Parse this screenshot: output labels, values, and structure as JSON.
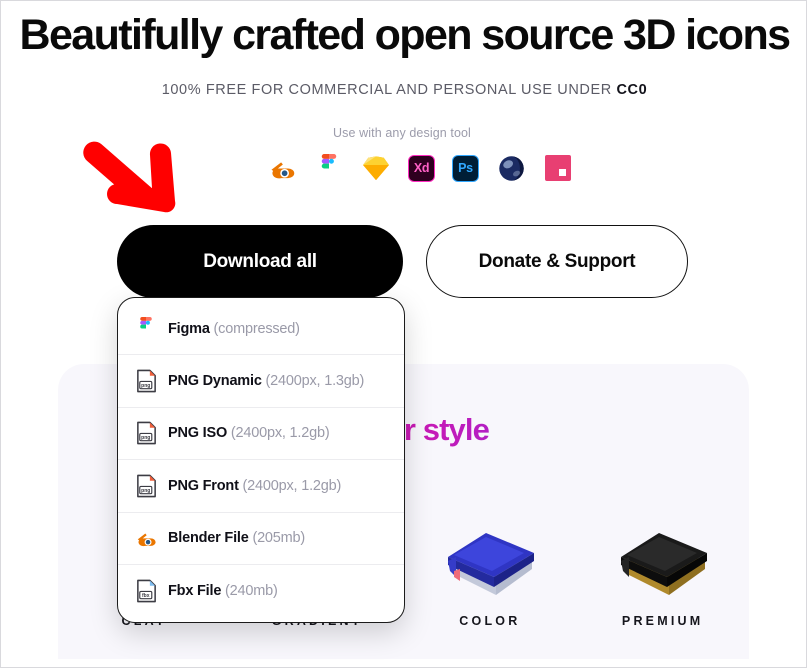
{
  "hero": {
    "title": "Beautifully crafted open source 3D icons",
    "subtitle_prefix": "100% FREE FOR COMMERCIAL AND PERSONAL USE UNDER ",
    "license": "CC0"
  },
  "tools": {
    "caption": "Use with any design tool",
    "items": [
      {
        "name": "blender-icon",
        "label": "Blender"
      },
      {
        "name": "figma-icon",
        "label": "Figma"
      },
      {
        "name": "sketch-icon",
        "label": "Sketch"
      },
      {
        "name": "adobe-xd-icon",
        "label": "Xd"
      },
      {
        "name": "photoshop-icon",
        "label": "Ps"
      },
      {
        "name": "cinema4d-icon",
        "label": "Cinema 4D"
      },
      {
        "name": "invision-icon",
        "label": "InVision"
      }
    ]
  },
  "actions": {
    "download_all": "Download all",
    "donate": "Donate & Support"
  },
  "annotation": {
    "arrow": "red-arrow-pointing-at-download-all",
    "color": "#FF0000"
  },
  "dropdown": {
    "items": [
      {
        "icon": "figma-icon",
        "name": "Figma",
        "meta": "(compressed)"
      },
      {
        "icon": "png-file-icon",
        "name": "PNG Dynamic",
        "meta": "(2400px, 1.3gb)"
      },
      {
        "icon": "png-file-icon",
        "name": "PNG ISO",
        "meta": "(2400px, 1.2gb)"
      },
      {
        "icon": "png-file-icon",
        "name": "PNG Front",
        "meta": "(2400px, 1.2gb)"
      },
      {
        "icon": "blender-icon",
        "name": "Blender File",
        "meta": "(205mb)"
      },
      {
        "icon": "fbx-file-icon",
        "name": "Fbx File",
        "meta": "(240mb)"
      }
    ]
  },
  "panel": {
    "heading": "d color style",
    "heading_gradient_from": "#F0108E",
    "heading_gradient_to": "#7B30E8",
    "background": "#F8F7FC",
    "styles": [
      {
        "label": "CLAY",
        "art": "none"
      },
      {
        "label": "GRADIENT",
        "art": "none"
      },
      {
        "label": "COLOR",
        "art": "blue-book-3d-icon"
      },
      {
        "label": "PREMIUM",
        "art": "black-gold-book-3d-icon"
      }
    ]
  }
}
